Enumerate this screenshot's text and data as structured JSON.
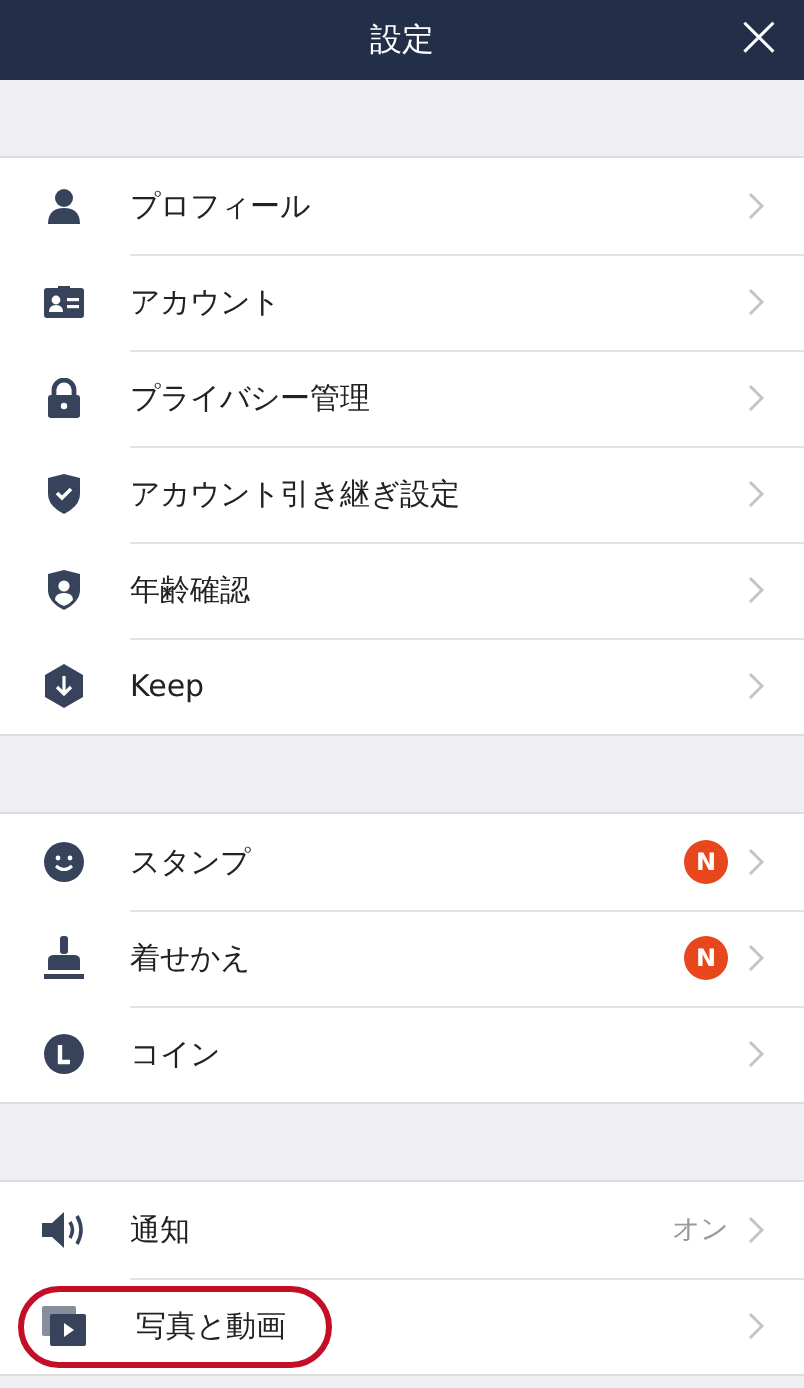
{
  "header": {
    "title": "設定",
    "close": "×"
  },
  "sections": [
    {
      "items": [
        {
          "label": "プロフィール"
        },
        {
          "label": "アカウント"
        },
        {
          "label": "プライバシー管理"
        },
        {
          "label": "アカウント引き継ぎ設定"
        },
        {
          "label": "年齢確認"
        },
        {
          "label": "Keep"
        }
      ]
    },
    {
      "items": [
        {
          "label": "スタンプ",
          "badge": "N"
        },
        {
          "label": "着せかえ",
          "badge": "N"
        },
        {
          "label": "コイン"
        }
      ]
    },
    {
      "items": [
        {
          "label": "通知",
          "value": "オン"
        },
        {
          "label": "写真と動画",
          "highlighted": true
        }
      ]
    }
  ]
}
